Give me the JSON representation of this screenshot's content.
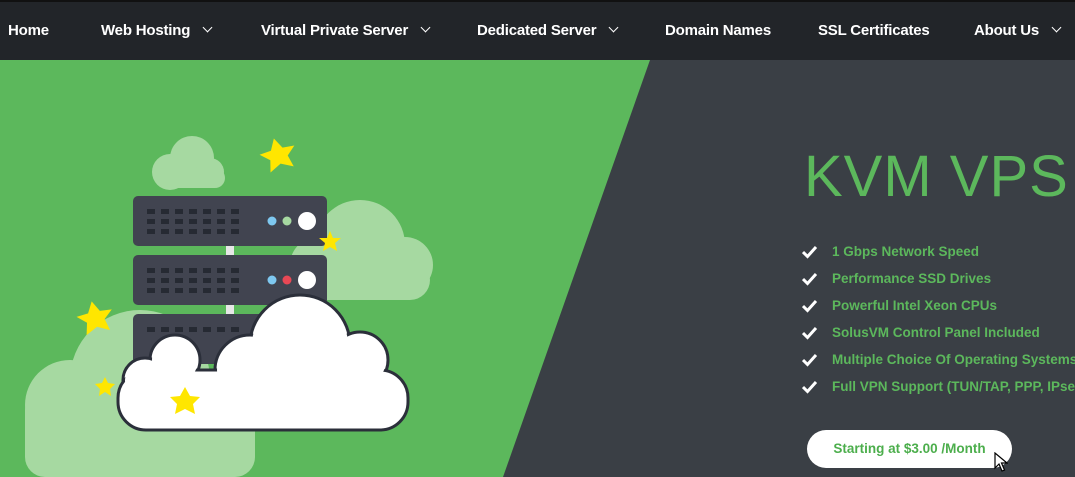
{
  "nav": {
    "items": [
      {
        "label": "Home",
        "has_dropdown": false
      },
      {
        "label": "Web Hosting",
        "has_dropdown": true
      },
      {
        "label": "Virtual Private Server",
        "has_dropdown": true
      },
      {
        "label": "Dedicated Server",
        "has_dropdown": true
      },
      {
        "label": "Domain Names",
        "has_dropdown": false
      },
      {
        "label": "SSL Certificates",
        "has_dropdown": false
      },
      {
        "label": "About Us",
        "has_dropdown": true
      }
    ]
  },
  "hero": {
    "title": "KVM VPS",
    "features": [
      "1 Gbps Network Speed",
      "Performance SSD Drives",
      "Powerful Intel Xeon CPUs",
      "SolusVM Control Panel Included",
      "Multiple Choice Of Operating Systems",
      "Full VPN Support (TUN/TAP, PPP, IPsec)"
    ],
    "cta_label": "Starting at $3.00 /Month",
    "icons": [
      "server-rack-illustration",
      "cloud-icon",
      "star-icon",
      "check-icon",
      "mouse-cursor-icon"
    ]
  },
  "colors": {
    "nav_bg": "#222529",
    "hero_green": "#5cb85c",
    "hero_dark": "#3a3f45",
    "accent_green": "#5cb85c",
    "star_yellow": "#ffe600"
  }
}
